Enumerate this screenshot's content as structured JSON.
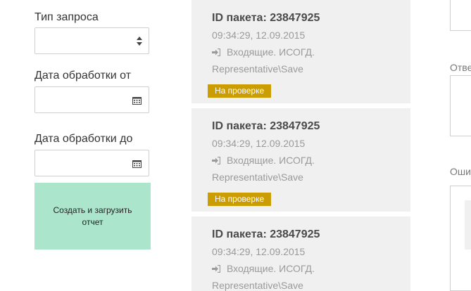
{
  "form": {
    "request_type_label": "Тип запроса",
    "request_type_value": "",
    "date_from_label": "Дата обработки от",
    "date_from_value": "",
    "date_to_label": "Дата обработки до",
    "date_to_value": "",
    "create_button_label": "Создать и загрузить отчет"
  },
  "packages": [
    {
      "title": "ID пакета: 23847925",
      "time": "09:34:29, 12.09.2015",
      "type": "Входящие. ИСОГД.",
      "path": "Representative\\Save",
      "status": "На проверке",
      "status_color": "#cc9d00"
    },
    {
      "title": "ID пакета: 23847925",
      "time": "09:34:29, 12.09.2015",
      "type": "Входящие. ИСОГД.",
      "path": "Representative\\Save",
      "status": "На проверке",
      "status_color": "#cc9d00"
    },
    {
      "title": "ID пакета: 23847925",
      "time": "09:34:29, 12.09.2015",
      "type": "Входящие. ИСОГД.",
      "path": "Representative\\Save",
      "status": "",
      "status_color": "#cc9d00"
    }
  ],
  "right_panel": {
    "label_1": "Отве",
    "label_2": "Оши"
  },
  "icons": {
    "select": "select-arrows-icon",
    "calendar": "calendar-icon",
    "incoming": "sign-in-icon"
  }
}
